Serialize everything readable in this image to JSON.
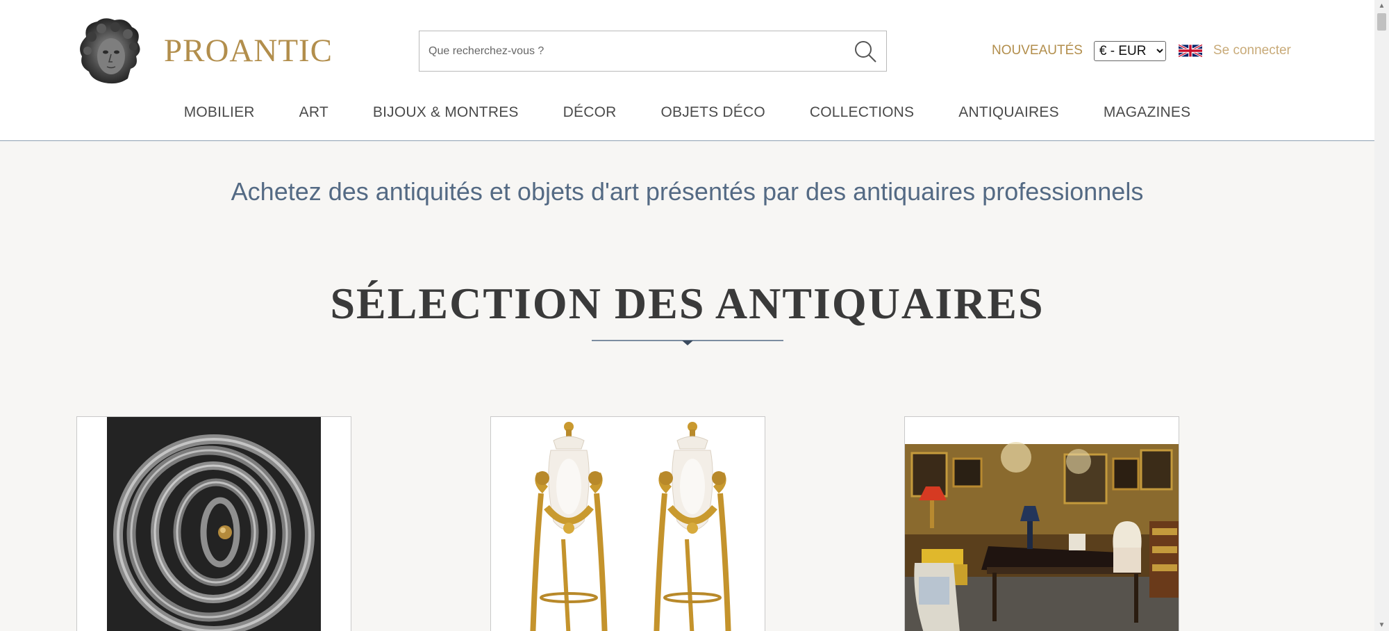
{
  "brand": {
    "name": "PROANTIC",
    "color": "#b28e4c"
  },
  "search": {
    "placeholder": "Que recherchez-vous ?"
  },
  "header_links": {
    "nouveautes": "NOUVEAUTÉS",
    "currency": {
      "selected": "€ - EUR",
      "options": [
        "€ - EUR"
      ]
    },
    "language_flag": "uk-flag-icon",
    "login": "Se connecter"
  },
  "nav": {
    "items": [
      {
        "label": "MOBILIER"
      },
      {
        "label": "ART"
      },
      {
        "label": "BIJOUX & MONTRES"
      },
      {
        "label": "DÉCOR"
      },
      {
        "label": "OBJETS DÉCO"
      },
      {
        "label": "COLLECTIONS"
      },
      {
        "label": "ANTIQUAIRES"
      },
      {
        "label": "MAGAZINES"
      }
    ]
  },
  "main": {
    "tagline": "Achetez des antiquités et objets d'art présentés par des antiquaires professionnels",
    "section_title": "SÉLECTION DES ANTIQUAIRES"
  },
  "products": [
    {
      "image": "metal-spiral-sculpture-image"
    },
    {
      "image": "alabaster-bronze-vases-pair-image"
    },
    {
      "image": "antique-shop-interior-image"
    }
  ],
  "colors": {
    "accent": "#b28e4c",
    "tagline": "#546a84",
    "header_border": "#8ea0b2",
    "background": "#f7f6f4"
  }
}
